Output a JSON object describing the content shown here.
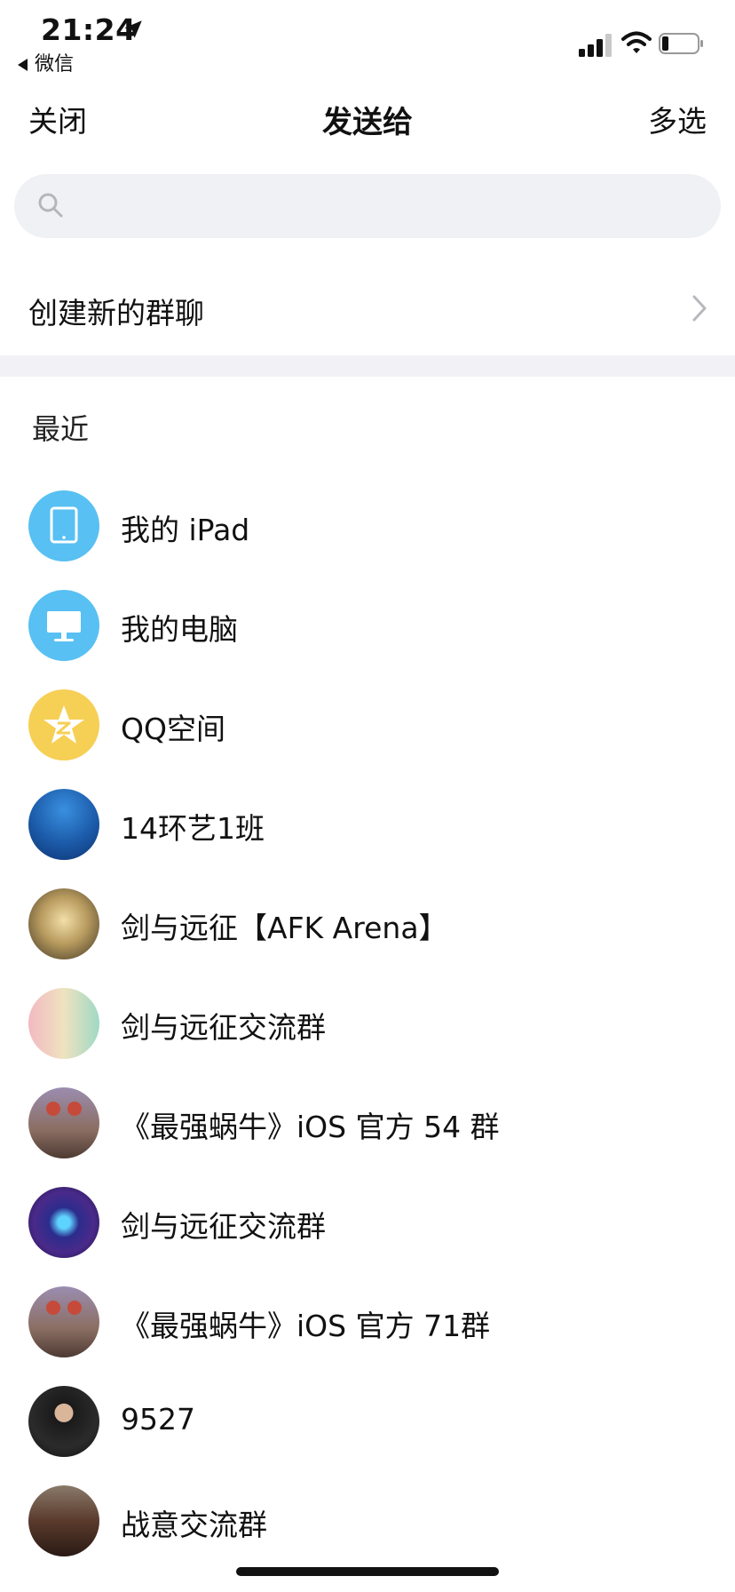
{
  "status_bar": {
    "time": "21:24",
    "back_app": "微信",
    "icons": [
      "location-arrow-icon",
      "cellular-signal-icon",
      "wifi-icon",
      "battery-icon"
    ]
  },
  "nav": {
    "left": "关闭",
    "title": "发送给",
    "right": "多选"
  },
  "search": {
    "placeholder": ""
  },
  "create_group": {
    "label": "创建新的群聊"
  },
  "recent": {
    "title": "最近",
    "items": [
      {
        "label": "我的 iPad",
        "avatar": "ipad-icon",
        "color": "#58c0f2"
      },
      {
        "label": "我的电脑",
        "avatar": "computer-icon",
        "color": "#58c0f2"
      },
      {
        "label": "QQ空间",
        "avatar": "qzone-star-icon",
        "color": "#f6cf55"
      },
      {
        "label": "14环艺1班",
        "avatar": "group-avatar",
        "color": "#1e5fb0"
      },
      {
        "label": "剑与远征【AFK Arena】",
        "avatar": "group-avatar",
        "color": "#8a7550"
      },
      {
        "label": "剑与远征交流群",
        "avatar": "group-avatar",
        "color": "#d9c49a"
      },
      {
        "label": "《最强蜗牛》iOS 官方 54 群",
        "avatar": "group-avatar",
        "color": "#8a6f6a"
      },
      {
        "label": "剑与远征交流群",
        "avatar": "group-avatar",
        "color": "#3b2a8c"
      },
      {
        "label": "《最强蜗牛》iOS 官方 71群",
        "avatar": "group-avatar",
        "color": "#8a6f6a"
      },
      {
        "label": "9527",
        "avatar": "person-avatar",
        "color": "#2a2a2a"
      },
      {
        "label": "战意交流群",
        "avatar": "group-avatar",
        "color": "#4a3326"
      }
    ]
  }
}
